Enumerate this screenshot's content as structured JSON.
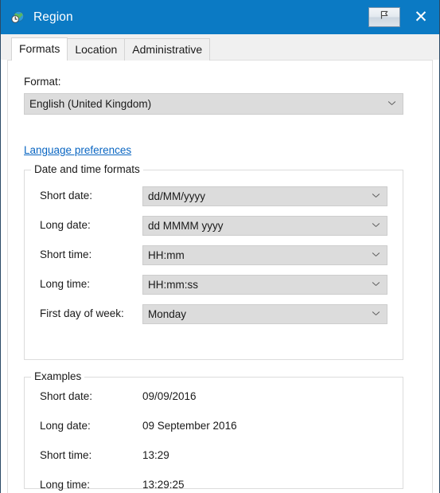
{
  "window": {
    "title": "Region",
    "icon": "region-globe-clock-icon",
    "accent_color": "#0b7ac4",
    "close_label": "✕",
    "help_button_label": "",
    "help_button_icon": "pointer-flag-icon"
  },
  "tabs": [
    {
      "label": "Formats",
      "selected": true
    },
    {
      "label": "Location",
      "selected": false
    },
    {
      "label": "Administrative",
      "selected": false
    }
  ],
  "format_section": {
    "label": "Format:",
    "value": "English (United Kingdom)",
    "link": "Language preferences"
  },
  "date_time_group": {
    "legend": "Date and time formats",
    "rows": [
      {
        "label": "Short date:",
        "value": "dd/MM/yyyy"
      },
      {
        "label": "Long date:",
        "value": "dd MMMM yyyy"
      },
      {
        "label": "Short time:",
        "value": "HH:mm"
      },
      {
        "label": "Long time:",
        "value": "HH:mm:ss"
      },
      {
        "label": "First day of week:",
        "value": "Monday"
      }
    ]
  },
  "examples_group": {
    "legend": "Examples",
    "rows": [
      {
        "label": "Short date:",
        "value": "09/09/2016"
      },
      {
        "label": "Long date:",
        "value": "09 September 2016"
      },
      {
        "label": "Short time:",
        "value": "13:29"
      },
      {
        "label": "Long time:",
        "value": "13:29:25"
      }
    ]
  }
}
